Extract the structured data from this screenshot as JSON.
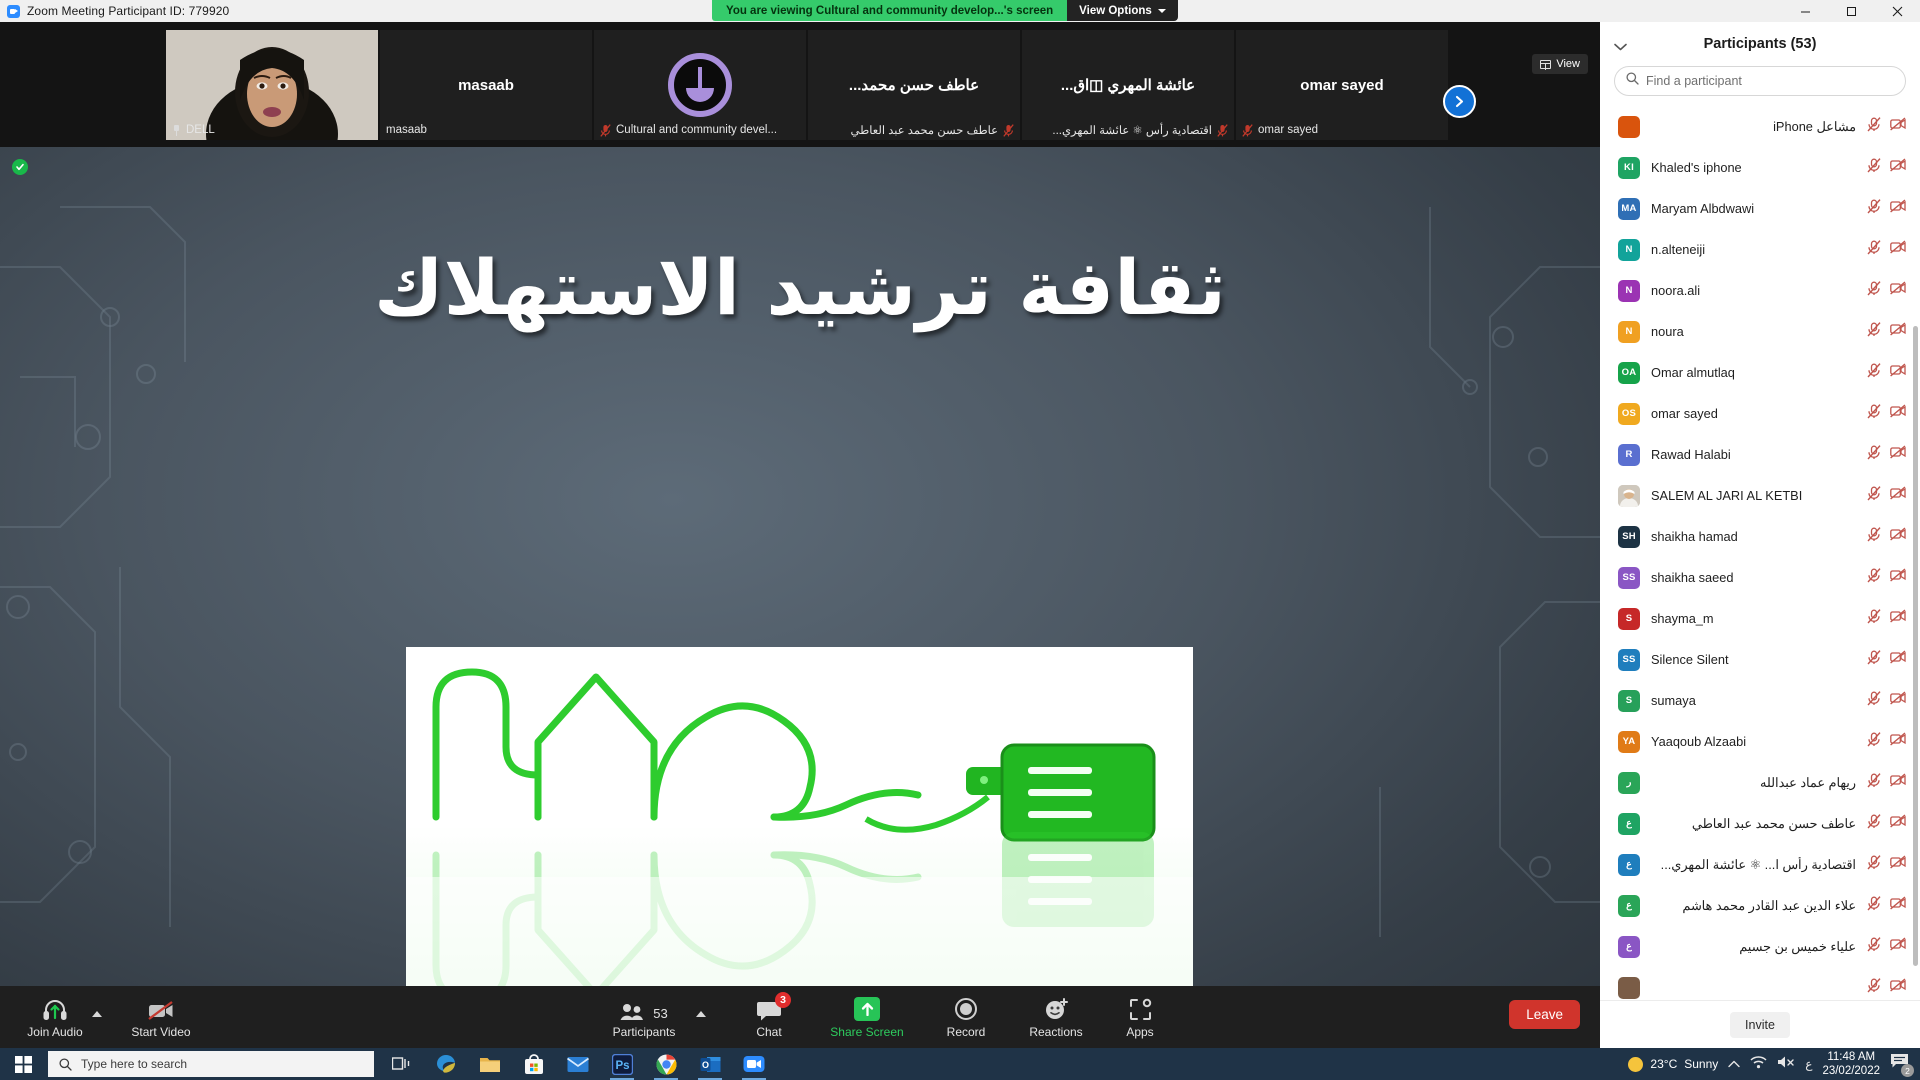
{
  "window": {
    "title": "Zoom Meeting Participant ID: 779920",
    "minimize_label": "Minimize",
    "maximize_label": "Maximize",
    "close_label": "Close"
  },
  "share_banner": {
    "message": "You are viewing Cultural and community develop...'s screen",
    "view_options_label": "View Options",
    "accent_color": "#35cb6b"
  },
  "filmstrip": {
    "view_button_label": "View",
    "next_label": "Next page",
    "tiles": [
      {
        "center_name": "",
        "footer_name": "DELL",
        "pinned": true,
        "muted": false,
        "kind": "video",
        "rtl": false
      },
      {
        "center_name": "masaab",
        "footer_name": "masaab",
        "pinned": false,
        "muted": false,
        "kind": "name",
        "rtl": false
      },
      {
        "center_name": "",
        "footer_name": "Cultural and community devel...",
        "pinned": false,
        "muted": true,
        "kind": "logo",
        "rtl": false
      },
      {
        "center_name": "عاطف حسن محمد...",
        "footer_name": "عاطف حسن محمد عبد العاطي",
        "pinned": false,
        "muted": true,
        "kind": "name",
        "rtl": true
      },
      {
        "center_name": "عائشة المهري ◫اق...",
        "footer_name": "اقتصادية رأس ⚛ عائشة المهري...",
        "pinned": false,
        "muted": true,
        "kind": "name",
        "rtl": true
      },
      {
        "center_name": "omar sayed",
        "footer_name": "omar sayed",
        "pinned": false,
        "muted": true,
        "kind": "name",
        "rtl": false
      }
    ]
  },
  "stage": {
    "slide_title": "ثقافة ترشيد الاستهلاك",
    "recording_indicator": "recording-active"
  },
  "toolbar": {
    "left": [
      {
        "name": "join-audio",
        "label": "Join Audio",
        "icon": "headset-join-icon",
        "has_caret": true
      },
      {
        "name": "start-video",
        "label": "Start Video",
        "icon": "camera-off-icon",
        "has_caret": false
      }
    ],
    "center": [
      {
        "name": "participants",
        "label": "Participants",
        "icon": "people-icon",
        "count": "53",
        "has_caret": true
      },
      {
        "name": "chat",
        "label": "Chat",
        "icon": "chat-bubble-icon",
        "badge": "3"
      },
      {
        "name": "share-screen",
        "label": "Share Screen",
        "icon": "share-up-arrow-icon",
        "highlight": "#27c457"
      },
      {
        "name": "record",
        "label": "Record",
        "icon": "record-circle-icon"
      },
      {
        "name": "reactions",
        "label": "Reactions",
        "icon": "smiley-plus-icon"
      },
      {
        "name": "apps",
        "label": "Apps",
        "icon": "apps-bracket-icon"
      }
    ],
    "leave_label": "Leave",
    "leave_color": "#d0342c"
  },
  "participants_panel": {
    "title": "Participants (53)",
    "search_placeholder": "Find a participant",
    "search_value": "",
    "invite_label": "Invite",
    "mute_icon_label": "microphone-muted-icon",
    "video_icon_label": "camera-off-icon",
    "list": [
      {
        "name": "مشاعل iPhone",
        "initials": "",
        "color": "#d9540d",
        "rtl": true,
        "photo": false
      },
      {
        "name": "Khaled's iphone",
        "initials": "KI",
        "color": "#1fa463",
        "rtl": false,
        "photo": false
      },
      {
        "name": "Maryam Albdwawi",
        "initials": "MA",
        "color": "#2f6fb5",
        "rtl": false,
        "photo": false
      },
      {
        "name": "n.alteneiji",
        "initials": "N",
        "color": "#12a39a",
        "rtl": false,
        "photo": false
      },
      {
        "name": "noora.ali",
        "initials": "N",
        "color": "#9b33b3",
        "rtl": false,
        "photo": false
      },
      {
        "name": "noura",
        "initials": "N",
        "color": "#f0a022",
        "rtl": false,
        "photo": false
      },
      {
        "name": "Omar almutlaq",
        "initials": "OA",
        "color": "#16a34a",
        "rtl": false,
        "photo": false
      },
      {
        "name": "omar sayed",
        "initials": "OS",
        "color": "#f0a91f",
        "rtl": false,
        "photo": false
      },
      {
        "name": "Rawad Halabi",
        "initials": "R",
        "color": "#5a6fd0",
        "rtl": false,
        "photo": false
      },
      {
        "name": "SALEM AL JARI AL KETBI",
        "initials": "",
        "color": "#c9c4bd",
        "rtl": false,
        "photo": true
      },
      {
        "name": "shaikha hamad",
        "initials": "SH",
        "color": "#1d3344",
        "rtl": false,
        "photo": false
      },
      {
        "name": "shaikha saeed",
        "initials": "SS",
        "color": "#8a56c4",
        "rtl": false,
        "photo": false
      },
      {
        "name": "shayma_m",
        "initials": "S",
        "color": "#c62828",
        "rtl": false,
        "photo": false
      },
      {
        "name": "Silence Silent",
        "initials": "SS",
        "color": "#1f7ebd",
        "rtl": false,
        "photo": false
      },
      {
        "name": "sumaya",
        "initials": "S",
        "color": "#27a05a",
        "rtl": false,
        "photo": false
      },
      {
        "name": "Yaaqoub Alzaabi",
        "initials": "YA",
        "color": "#e07b17",
        "rtl": false,
        "photo": false
      },
      {
        "name": "ريهام عماد عبدالله",
        "initials": "ر",
        "color": "#2aa558",
        "rtl": true,
        "photo": false
      },
      {
        "name": "عاطف حسن محمد عبد العاطي",
        "initials": "ع",
        "color": "#1fa463",
        "rtl": true,
        "photo": false
      },
      {
        "name": "اقتصادية رأس ا... ⚛ عائشة المهري...",
        "initials": "ع",
        "color": "#1f7ebd",
        "rtl": true,
        "photo": false
      },
      {
        "name": "علاء الدين عبد القادر محمد هاشم",
        "initials": "ع",
        "color": "#2aa558",
        "rtl": true,
        "photo": false
      },
      {
        "name": "علياء خميس بن جسيم",
        "initials": "ع",
        "color": "#8a56c4",
        "rtl": true,
        "photo": false
      },
      {
        "name": "",
        "initials": "",
        "color": "#7a5c46",
        "rtl": true,
        "photo": false
      }
    ]
  },
  "taskbar": {
    "start_label": "Start",
    "search_placeholder": "Type here to search",
    "apps": [
      {
        "name": "task-view",
        "label": "Task View"
      },
      {
        "name": "edge",
        "label": "Microsoft Edge"
      },
      {
        "name": "file-explorer",
        "label": "File Explorer"
      },
      {
        "name": "microsoft-store",
        "label": "Microsoft Store"
      },
      {
        "name": "mail",
        "label": "Mail"
      },
      {
        "name": "photoshop",
        "label": "Adobe Photoshop"
      },
      {
        "name": "chrome",
        "label": "Google Chrome"
      },
      {
        "name": "outlook",
        "label": "Outlook"
      },
      {
        "name": "zoom",
        "label": "Zoom"
      }
    ],
    "weather_temp": "23°C",
    "weather_cond": "Sunny",
    "time": "11:48 AM",
    "date": "23/02/2022",
    "notification_count": "2"
  }
}
